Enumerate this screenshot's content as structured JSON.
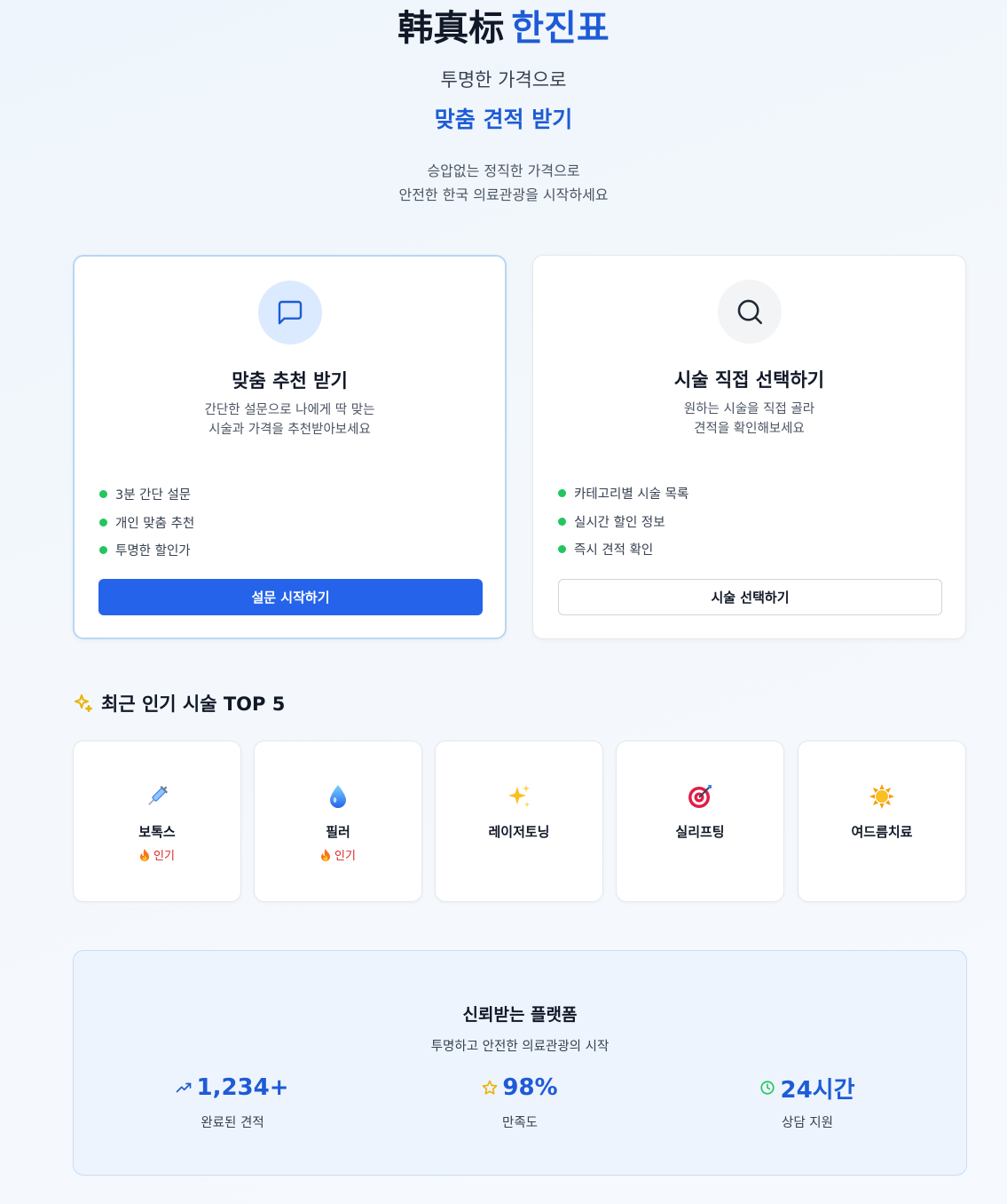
{
  "brand": {
    "cn": "韩真标",
    "kr": "한진표"
  },
  "hero": {
    "subtitle": "투명한 가격으로",
    "highlight": "맞춤 견적 받기",
    "desc_line1": "승압없는 정직한 가격으로",
    "desc_line2": "안전한 한국 의료관광을 시작하세요"
  },
  "cards": [
    {
      "icon": "chat-bubble-icon",
      "title": "맞춤 추천 받기",
      "desc_line1": "간단한 설문으로 나에게 딱 맞는",
      "desc_line2": "시술과 가격을 추천받아보세요",
      "features": [
        "3분 간단 설문",
        "개인 맞춤 추천",
        "투명한 할인가"
      ],
      "button": "설문 시작하기"
    },
    {
      "icon": "search-icon",
      "title": "시술 직접 선택하기",
      "desc_line1": "원하는 시술을 직접 골라",
      "desc_line2": "견적을 확인해보세요",
      "features": [
        "카테고리별 시술 목록",
        "실시간 할인 정보",
        "즉시 견적 확인"
      ],
      "button": "시술 선택하기"
    }
  ],
  "popular": {
    "title": "최근 인기 시술 TOP 5",
    "items": [
      {
        "name": "보톡스",
        "icon": "syringe-icon",
        "badge": "인기"
      },
      {
        "name": "필러",
        "icon": "droplet-icon",
        "badge": "인기"
      },
      {
        "name": "레이저토닝",
        "icon": "sparkles-icon",
        "badge": ""
      },
      {
        "name": "실리프팅",
        "icon": "target-icon",
        "badge": ""
      },
      {
        "name": "여드름치료",
        "icon": "sun-icon",
        "badge": ""
      }
    ]
  },
  "trust": {
    "title": "신뢰받는 플랫폼",
    "subtitle": "투명하고 안전한 의료관광의 시작",
    "stats": [
      {
        "icon": "trending-up-icon",
        "value": "1,234+",
        "label": "완료된 견적"
      },
      {
        "icon": "star-icon",
        "value": "98%",
        "label": "만족도"
      },
      {
        "icon": "clock-icon",
        "value": "24시간",
        "label": "상담 지원"
      }
    ]
  },
  "colors": {
    "accent": "#1e5bd6",
    "button": "#2563eb",
    "check": "#22c55e",
    "hot": "#dc2626"
  }
}
